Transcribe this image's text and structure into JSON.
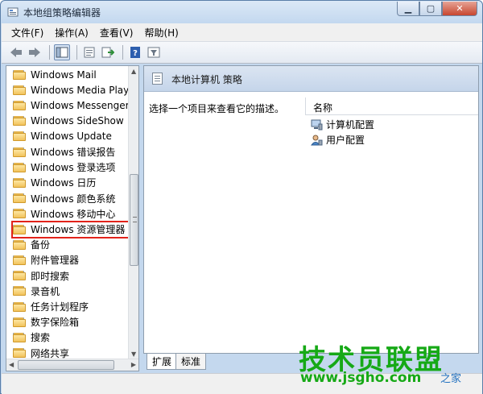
{
  "window": {
    "title": "本地组策略编辑器"
  },
  "menu": [
    "文件(F)",
    "操作(A)",
    "查看(V)",
    "帮助(H)"
  ],
  "toolbar": {
    "icons": [
      "back-arrow-icon",
      "forward-arrow-icon",
      "show-tree-icon",
      "properties-icon",
      "export-list-icon",
      "help-icon",
      "filter-view-icon"
    ]
  },
  "tree": {
    "items": [
      "Windows Mail",
      "Windows Media Playe",
      "Windows Messenger",
      "Windows SideShow",
      "Windows Update",
      "Windows 错误报告",
      "Windows 登录选项",
      "Windows 日历",
      "Windows 颜色系统",
      "Windows 移动中心",
      "Windows 资源管理器",
      "备份",
      "附件管理器",
      "即时搜索",
      "录音机",
      "任务计划程序",
      "数字保险箱",
      "搜索",
      "网络共享"
    ],
    "highlighted": "Windows 资源管理器"
  },
  "details": {
    "header_title": "本地计算机 策略",
    "description": "选择一个项目来查看它的描述。",
    "column_name": "名称",
    "rows": [
      "计算机配置",
      "用户配置"
    ]
  },
  "tabs": [
    "扩展",
    "标准"
  ],
  "watermark": {
    "brand": "技术员联盟",
    "url": "www.jsgho.com",
    "site": "之家"
  },
  "colors": {
    "highlight_border": "#e2231a",
    "watermark_green": "#16a916"
  }
}
